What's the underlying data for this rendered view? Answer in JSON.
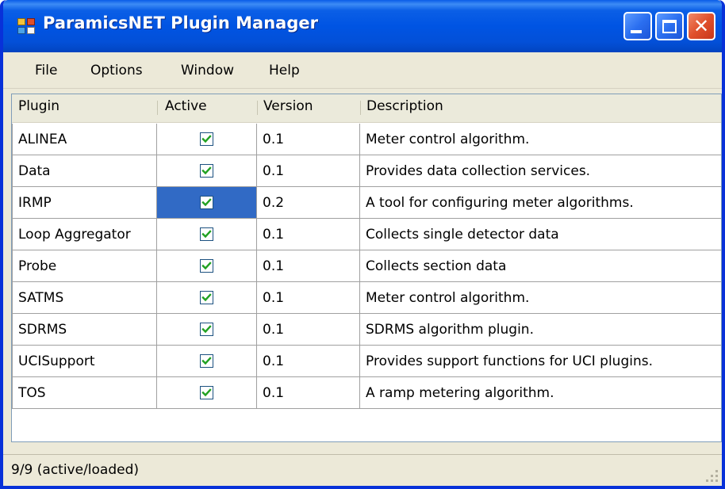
{
  "window": {
    "title": "ParamicsNET Plugin Manager"
  },
  "menu": {
    "items": [
      "File",
      "Options",
      "Window",
      "Help"
    ]
  },
  "grid": {
    "columns": [
      "Plugin",
      "Active",
      "Version",
      "Description"
    ],
    "rows": [
      {
        "plugin": "ALINEA",
        "active": true,
        "version": "0.1",
        "description": "Meter control algorithm."
      },
      {
        "plugin": "Data",
        "active": true,
        "version": "0.1",
        "description": "Provides data collection services."
      },
      {
        "plugin": "IRMP",
        "active": true,
        "version": "0.2",
        "description": "A tool for configuring meter algorithms."
      },
      {
        "plugin": "Loop Aggregator",
        "active": true,
        "version": "0.1",
        "description": "Collects single detector data"
      },
      {
        "plugin": "Probe",
        "active": true,
        "version": "0.1",
        "description": "Collects section data"
      },
      {
        "plugin": "SATMS",
        "active": true,
        "version": "0.1",
        "description": "Meter control algorithm."
      },
      {
        "plugin": "SDRMS",
        "active": true,
        "version": "0.1",
        "description": "SDRMS algorithm plugin."
      },
      {
        "plugin": "UCISupport",
        "active": true,
        "version": "0.1",
        "description": "Provides support functions for UCI plugins."
      },
      {
        "plugin": "TOS",
        "active": true,
        "version": "0.1",
        "description": "A ramp metering algorithm."
      }
    ],
    "selected_row": 2
  },
  "status": {
    "text": "9/9 (active/loaded)"
  },
  "colors": {
    "titlebar": "#0054e3",
    "selection": "#316ac5",
    "checkmark": "#21a121"
  },
  "icons": {
    "app": "app-icon",
    "minimize": "minimize-icon",
    "maximize": "maximize-icon",
    "close": "close-icon",
    "checkbox": "checkbox-checked-icon",
    "resize": "resize-grip-icon"
  }
}
